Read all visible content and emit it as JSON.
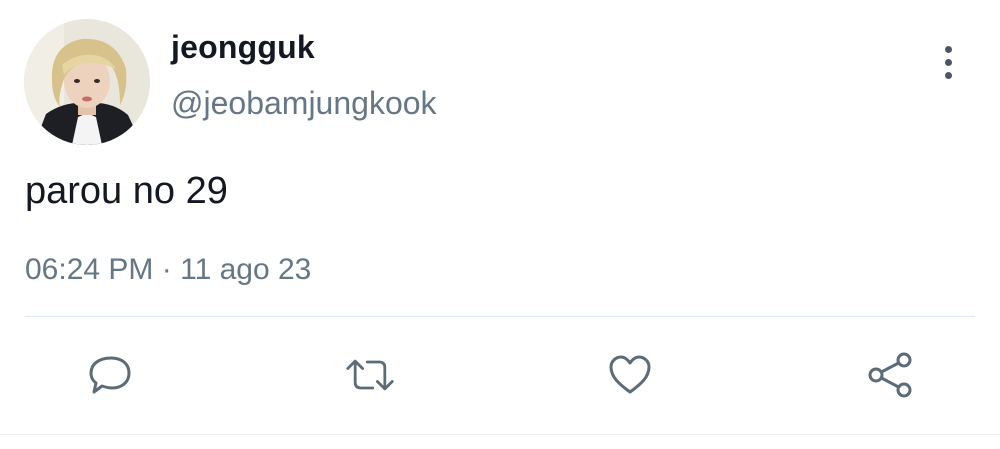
{
  "tweet": {
    "author": {
      "display_name": "jeongguk",
      "handle": "@jeobamjungkook"
    },
    "text": "parou no 29",
    "time": "06:24 PM",
    "separator": "·",
    "date": "11 ago 23"
  },
  "actions": [
    {
      "icon": "reply-icon"
    },
    {
      "icon": "retweet-icon"
    },
    {
      "icon": "like-icon"
    },
    {
      "icon": "share-icon"
    }
  ],
  "menu": {
    "icon": "more-vertical-icon"
  },
  "colors": {
    "text": "#141823",
    "secondary": "#657786",
    "icon": "#5b6b78",
    "divider": "#e1e8ed"
  }
}
